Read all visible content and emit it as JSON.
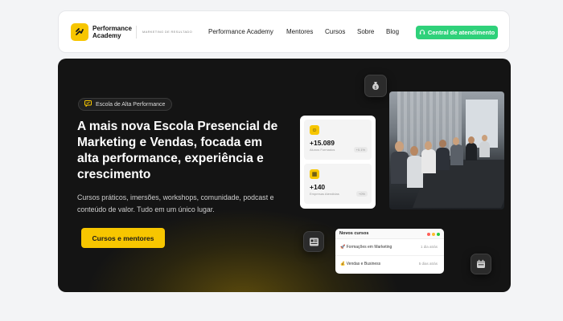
{
  "nav": {
    "brand_line1": "Performance",
    "brand_line2": "Academy",
    "tagline": "Marketing de Resultado",
    "links": [
      "Performance Academy",
      "Mentores",
      "Cursos",
      "Sobre",
      "Blog"
    ],
    "cta_label": "Central de atendimento"
  },
  "hero": {
    "badge": "Escola de Alta Performance",
    "title": "A mais nova Escola Presencial de Marketing e Vendas, focada em alta performance, experiência e crescimento",
    "subtitle": "Cursos práticos, imersões, workshops, comunidade, podcast e conteúdo de valor. Tudo em um único lugar.",
    "button_label": "Cursos e mentores"
  },
  "stats": [
    {
      "value": "+15.089",
      "label": "Alunos Formados",
      "chip": "+0.1%"
    },
    {
      "value": "+140",
      "label": "Empresas Atendidas",
      "chip": "+0%"
    }
  ],
  "courses": {
    "title": "Novos cursos",
    "items": [
      {
        "name": "🚀 Formações em Marketing",
        "time": "1 dia atrás"
      },
      {
        "name": "💰 Vendas e Business",
        "time": "5 dias atrás"
      }
    ]
  },
  "colors": {
    "accent": "#f7c600",
    "cta": "#2fd17a",
    "hero_bg": "#141414"
  },
  "icons": [
    "logo-icon",
    "chat-badge-icon",
    "headset-icon",
    "money-bag-icon",
    "document-icon",
    "calendar-icon"
  ]
}
